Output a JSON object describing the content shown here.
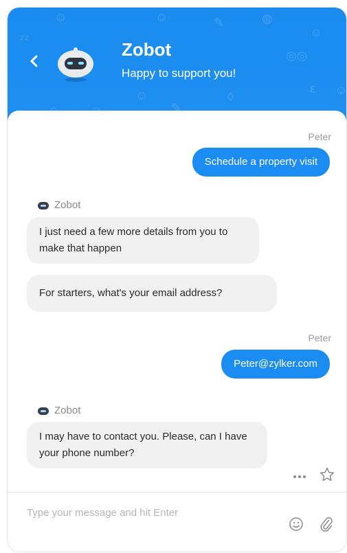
{
  "header": {
    "bot_name": "Zobot",
    "tagline": "Happy to support you!",
    "back_icon": "chevron-left-icon",
    "background_color": "#1a8cf0"
  },
  "messages": [
    {
      "side": "user",
      "sender": "Peter",
      "text": "Schedule a property visit"
    },
    {
      "side": "bot",
      "sender": "Zobot",
      "bubbles": [
        "I just need a few more details from you to make that happen",
        "For starters, what's your email address?"
      ]
    },
    {
      "side": "user",
      "sender": "Peter",
      "text": "Peter@zylker.com"
    },
    {
      "side": "bot",
      "sender": "Zobot",
      "bubbles": [
        "I may have to contact you. Please, can I have your phone number?"
      ]
    }
  ],
  "actions": {
    "more_icon": "more-dots-icon",
    "star_icon": "star-outline-icon",
    "more_label": "..."
  },
  "composer": {
    "placeholder": "Type your message and hit Enter",
    "emoji_icon": "emoji-icon",
    "attach_icon": "paperclip-icon"
  },
  "colors": {
    "user_bubble": "#1b8cf2",
    "bot_bubble": "#f1f1f1"
  }
}
